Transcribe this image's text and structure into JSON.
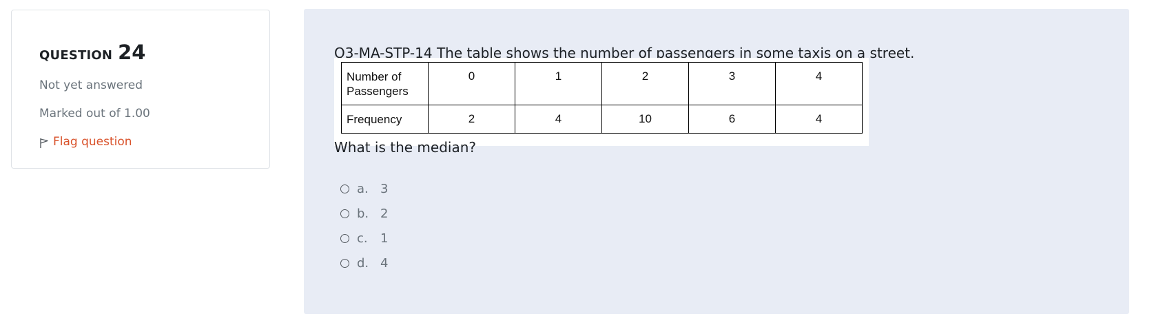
{
  "question_info": {
    "label": "QUESTION",
    "number": "24",
    "state": "Not yet answered",
    "grade": "Marked out of 1.00",
    "flag_label": "Flag question",
    "flag_icon": "flag-icon"
  },
  "question": {
    "text": "Q3-MA-STP-14 The table shows the number of passengers in some taxis on a street.",
    "prompt": "What is the median?",
    "table": {
      "rows": [
        {
          "header": "Number of Passengers",
          "cells": [
            "0",
            "1",
            "2",
            "3",
            "4"
          ]
        },
        {
          "header": "Frequency",
          "cells": [
            "2",
            "4",
            "10",
            "6",
            "4"
          ]
        }
      ]
    },
    "answers": [
      {
        "letter": "a.",
        "value": "3"
      },
      {
        "letter": "b.",
        "value": "2"
      },
      {
        "letter": "c.",
        "value": "1"
      },
      {
        "letter": "d.",
        "value": "4"
      }
    ]
  },
  "colors": {
    "panel_background": "#e8ecf5",
    "flag_link": "#d9532c",
    "muted_text": "#6a737b"
  }
}
